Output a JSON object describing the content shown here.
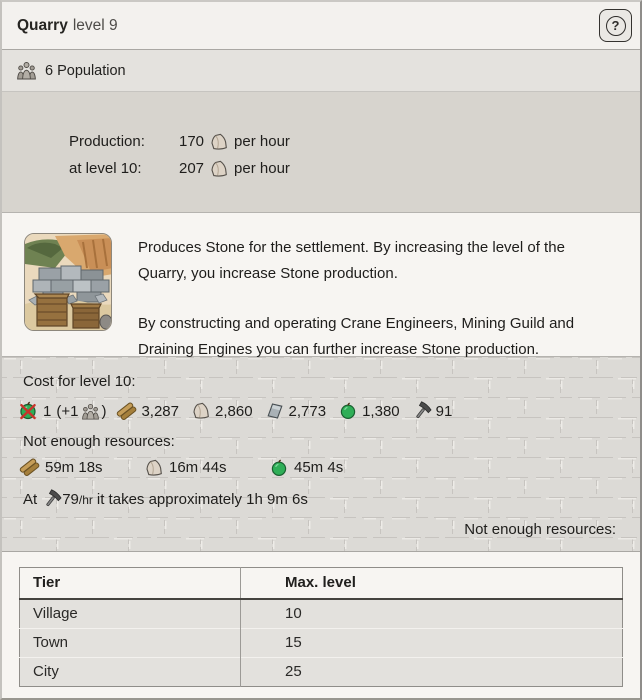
{
  "header": {
    "title": "Quarry",
    "subtitle": "level 9",
    "help_glyph": "?"
  },
  "population_bar": {
    "text": "6 Population"
  },
  "production": {
    "row1": {
      "label": "Production:",
      "value": "170",
      "unit": "per hour",
      "icon": "stone-icon"
    },
    "row2": {
      "label": "at level 10:",
      "value": "207",
      "unit": "per hour",
      "icon": "stone-icon"
    }
  },
  "description": {
    "image": "quarry-illustration",
    "paragraph1": "Produces Stone for the settlement. By increasing the level of the Quarry, you increase Stone production.",
    "paragraph2": "By constructing and operating Crane Engineers, Mining Guild and Draining Engines you can further increase Stone production."
  },
  "cost": {
    "title": "Cost for level 10:",
    "population": {
      "icon": "food-unavailable-icon",
      "value": "1",
      "plus_open": "(+1",
      "plus_icon": "population-icon",
      "plus_close": ")"
    },
    "resources": [
      {
        "icon": "wood-icon",
        "value": "3,287"
      },
      {
        "icon": "stone-icon",
        "value": "2,860"
      },
      {
        "icon": "iron-icon",
        "value": "2,773"
      },
      {
        "icon": "food-icon",
        "value": "1,380"
      },
      {
        "icon": "tools-icon",
        "value": "91"
      }
    ],
    "not_enough_label": "Not enough resources:",
    "wait_times": [
      {
        "icon": "wood-icon",
        "time": "59m 18s"
      },
      {
        "icon": "stone-icon",
        "time": "16m 44s"
      },
      {
        "icon": "food-icon",
        "time": "45m 4s"
      }
    ],
    "build_time": {
      "prefix": "At",
      "icon": "tools-icon",
      "rate": "79",
      "rate_unit": "/hr",
      "suffix": "it takes approximately 1h 9m 6s"
    },
    "not_enough_right": "Not enough resources:"
  },
  "tier_table": {
    "col1": "Tier",
    "col2": "Max. level",
    "rows": [
      {
        "tier": "Village",
        "max_level": "10"
      },
      {
        "tier": "Town",
        "max_level": "15"
      },
      {
        "tier": "City",
        "max_level": "25"
      }
    ]
  },
  "colors": {
    "food_green": "#2fae57",
    "alert_red": "#c9332b",
    "wood_brown": "#c59d58",
    "stone_beige": "#ddd3c6",
    "iron_gray": "#a9b1b6",
    "section_gray": "#d7d4ce",
    "brick_bg": "#dcdad6"
  }
}
